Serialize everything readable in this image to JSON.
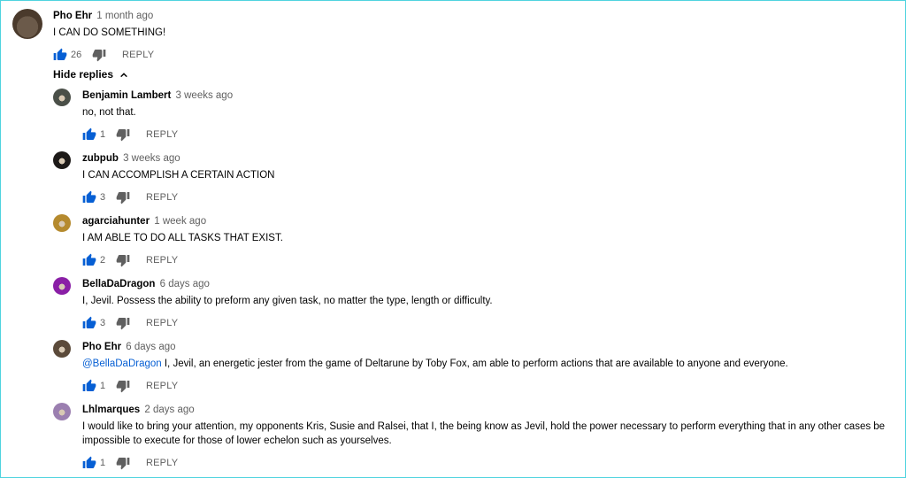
{
  "top_comment": {
    "author": "Pho Ehr",
    "time": "1 month ago",
    "text": "I CAN DO SOMETHING!",
    "likes": "26",
    "reply_label": "REPLY"
  },
  "hide_replies_label": "Hide replies",
  "replies": [
    {
      "author": "Benjamin Lambert",
      "time": "3 weeks ago",
      "text": "no, not that.",
      "likes": "1",
      "reply_label": "REPLY",
      "avatar_color": "#4a4f48"
    },
    {
      "author": "zubpub",
      "time": "3 weeks ago",
      "text": "I CAN ACCOMPLISH A CERTAIN ACTION",
      "likes": "3",
      "reply_label": "REPLY",
      "avatar_color": "#1d1a18"
    },
    {
      "author": "agarciahunter",
      "time": "1 week ago",
      "text": "I AM ABLE TO DO ALL TASKS THAT EXIST.",
      "likes": "2",
      "reply_label": "REPLY",
      "avatar_color": "#b58a2e"
    },
    {
      "author": "BellaDaDragon",
      "time": "6 days ago",
      "text": "I, Jevil. Possess the ability to preform any given task, no matter the type, length or difficulty.",
      "likes": "3",
      "reply_label": "REPLY",
      "avatar_color": "#8a1fa6"
    },
    {
      "author": "Pho Ehr",
      "time": "6 days ago",
      "mention": "@BellaDaDragon",
      "text": " I, Jevil, an energetic jester from the game of Deltarune by Toby Fox, am able to perform actions that are available to anyone and everyone.",
      "likes": "1",
      "reply_label": "REPLY",
      "avatar_color": "#5b4a3a"
    },
    {
      "author": "Lhlmarques",
      "time": "2 days ago",
      "text": "I would like to bring your attention, my opponents Kris, Susie and Ralsei, that I, the being know as Jevil, hold the power necessary  to perform everything that in any other cases be impossible to execute for those of lower echelon such as yourselves.",
      "likes": "1",
      "reply_label": "REPLY",
      "avatar_color": "#9b7fb0"
    }
  ],
  "colors": {
    "link": "#065fd4",
    "like_active": "#065fd4",
    "muted": "#606060"
  }
}
